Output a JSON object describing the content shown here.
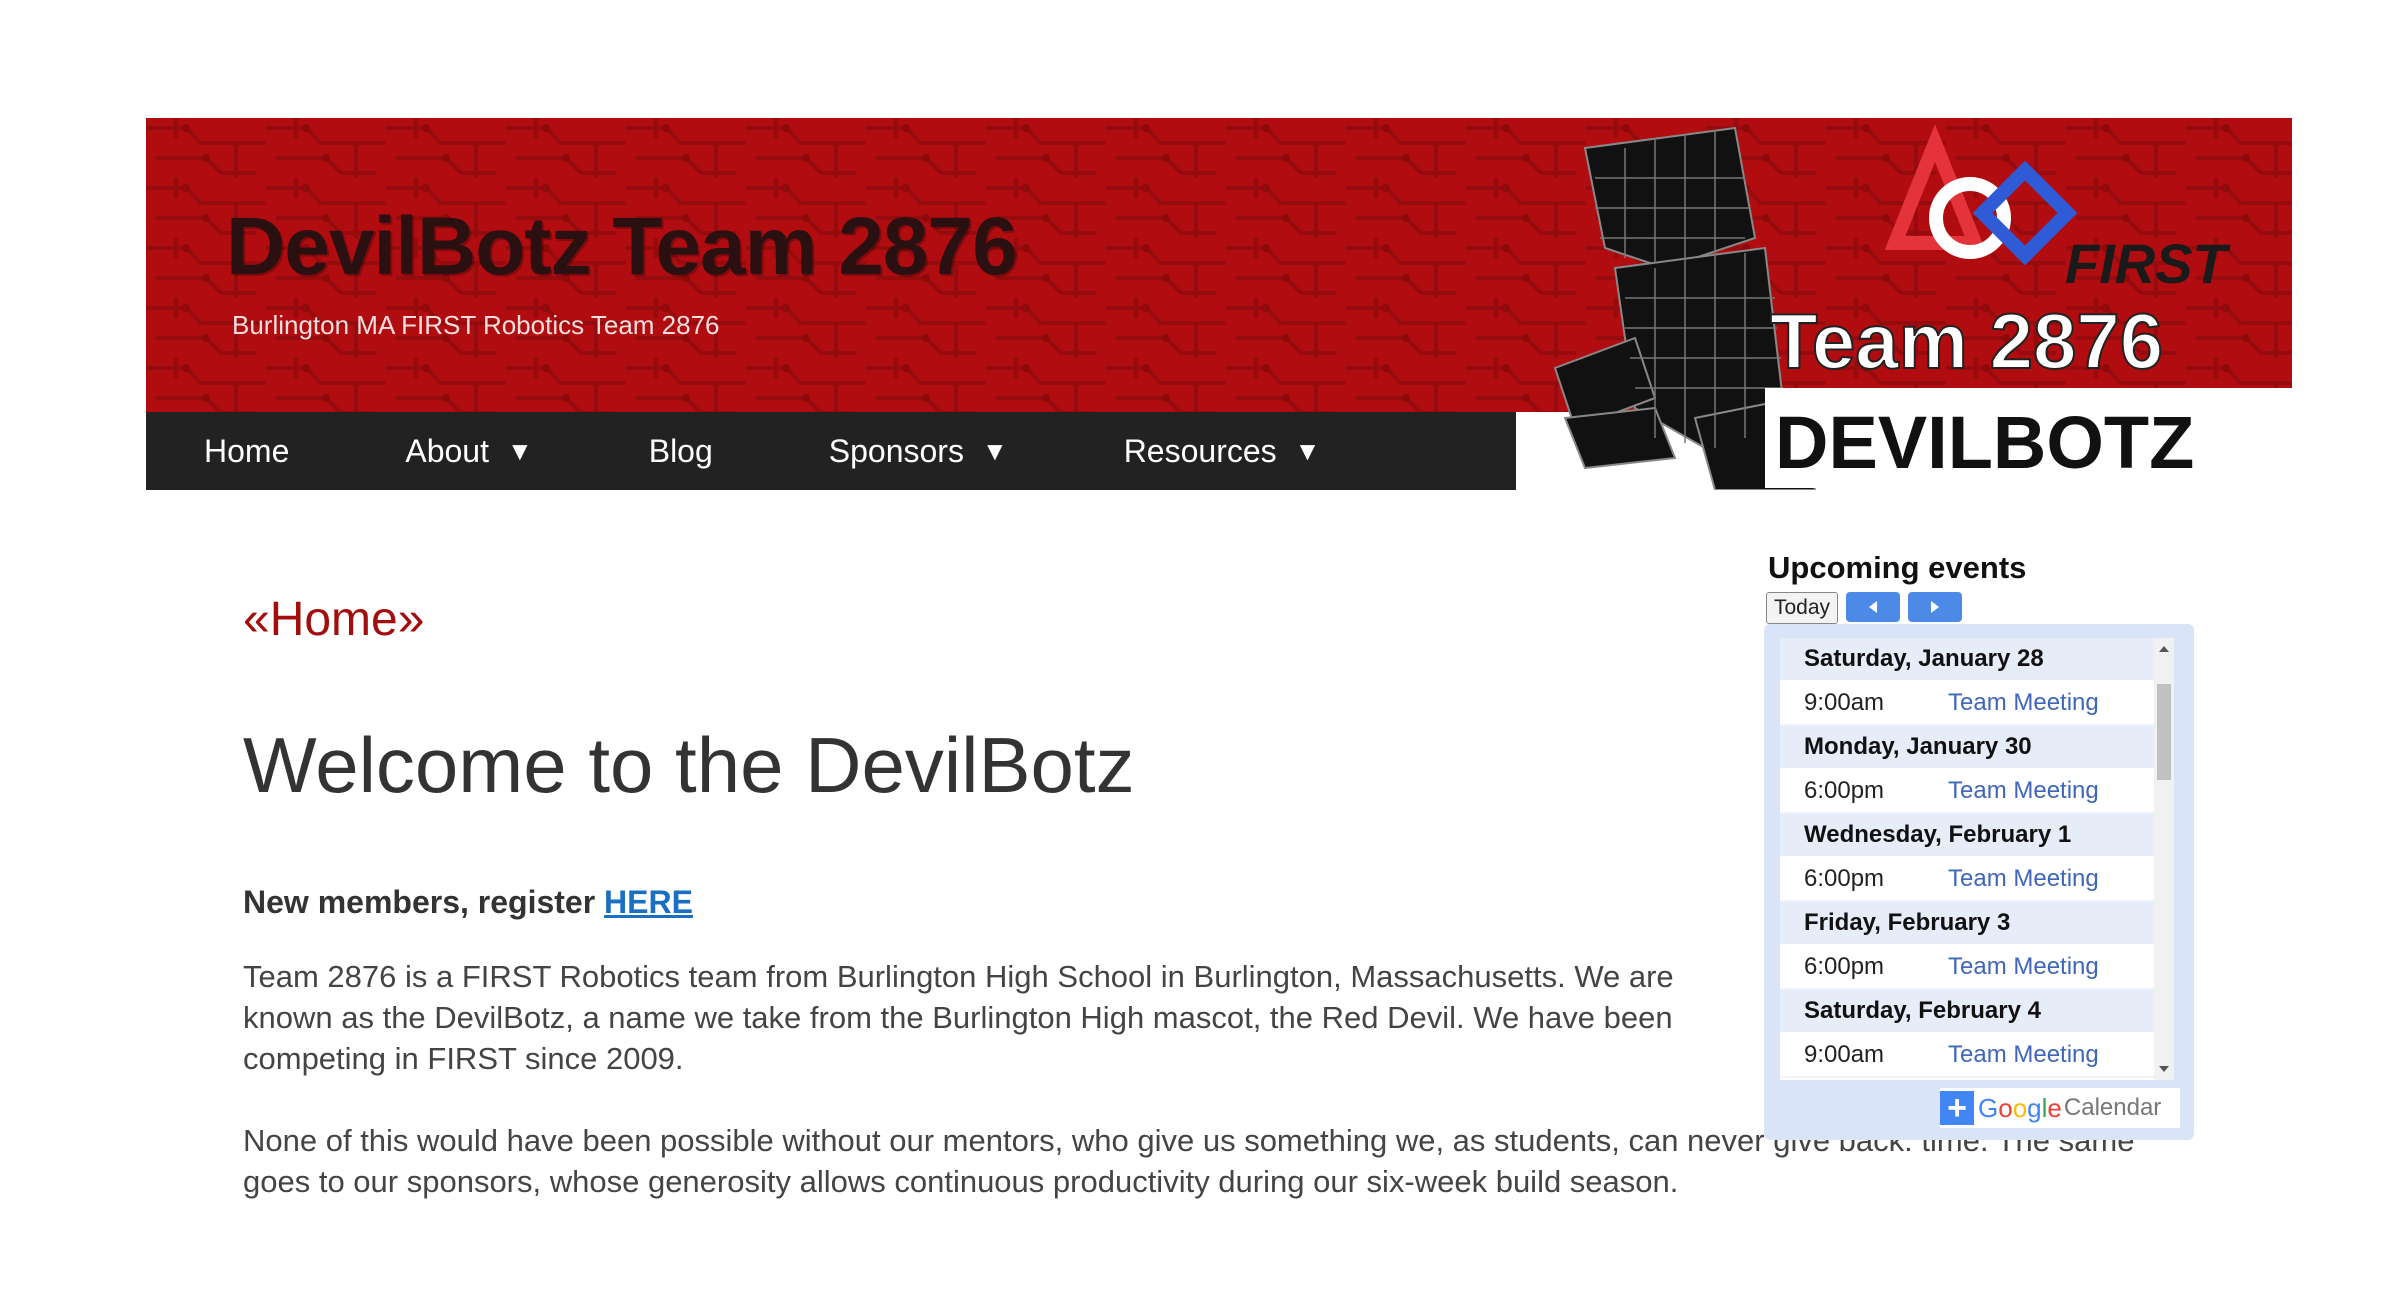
{
  "header": {
    "title": "DevilBotz Team 2876",
    "subtitle": "Burlington MA FIRST Robotics Team 2876",
    "logo": {
      "first_text": "FIRST",
      "team_text": "Team 2876",
      "name_text": "DEVILBOTZ"
    }
  },
  "nav": {
    "items": [
      {
        "label": "Home",
        "dropdown": false
      },
      {
        "label": "About",
        "dropdown": true
      },
      {
        "label": "Blog",
        "dropdown": false
      },
      {
        "label": "Sponsors",
        "dropdown": true
      },
      {
        "label": "Resources",
        "dropdown": true
      }
    ],
    "dropdown_glyph": "▼"
  },
  "main": {
    "breadcrumb": "«Home»",
    "heading": "Welcome to the DevilBotz",
    "register_text": "New members, register ",
    "register_link": "HERE",
    "paragraphs": [
      "Team 2876 is a FIRST Robotics team from Burlington High School in Burlington, Massachusetts. We are known as the DevilBotz, a name we take from the Burlington High mascot, the Red Devil. We have been competing in FIRST since 2009.",
      "None of this would have been possible without our mentors, who give us something we, as students, can never give back: time. The same goes to our sponsors, whose generosity allows continuous productivity during our six-week build season."
    ]
  },
  "calendar": {
    "title": "Upcoming events",
    "today_label": "Today",
    "days": [
      {
        "date": "Saturday, January 28",
        "events": [
          {
            "time": "9:00am",
            "title": "Team Meeting"
          }
        ]
      },
      {
        "date": "Monday, January 30",
        "events": [
          {
            "time": "6:00pm",
            "title": "Team Meeting"
          }
        ]
      },
      {
        "date": "Wednesday, February 1",
        "events": [
          {
            "time": "6:00pm",
            "title": "Team Meeting"
          }
        ]
      },
      {
        "date": "Friday, February 3",
        "events": [
          {
            "time": "6:00pm",
            "title": "Team Meeting"
          }
        ]
      },
      {
        "date": "Saturday, February 4",
        "events": [
          {
            "time": "9:00am",
            "title": "Team Meeting"
          }
        ]
      }
    ],
    "badge": {
      "plus": "+",
      "google_letters": [
        "G",
        "o",
        "o",
        "g",
        "l",
        "e"
      ],
      "calendar_word": "Calendar"
    }
  },
  "colors": {
    "header_red": "#b10d10",
    "nav_bg": "#222222",
    "breadcrumb_red": "#a30d0d",
    "link_blue": "#1a6fc2",
    "event_blue": "#3f66b8",
    "calendar_bg": "#dae4f8",
    "google_colors": [
      "#4285f4",
      "#ea4335",
      "#fbbc05",
      "#4285f4",
      "#34a853",
      "#ea4335"
    ]
  }
}
